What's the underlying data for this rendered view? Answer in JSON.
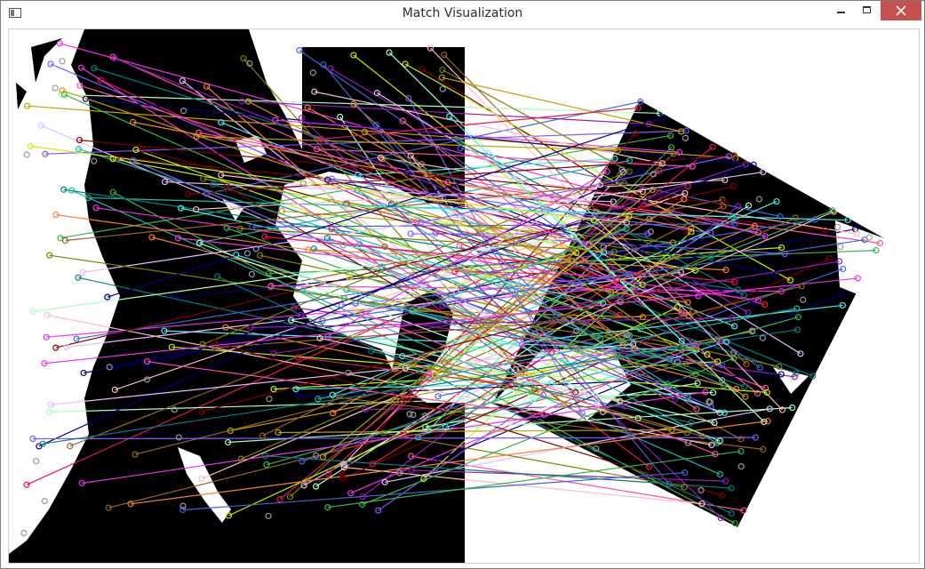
{
  "window": {
    "title": "Match Visualization"
  },
  "controls": {
    "minimize": "minimize",
    "maximize": "maximize",
    "close": "close"
  },
  "colors": {
    "close_button": "#c75050",
    "image_black": "#000000",
    "image_white": "#ffffff",
    "keypoint_gray": "#9a9a9a"
  },
  "visualization": {
    "left_image": "binary map image",
    "right_image": "rotated binary map image",
    "match_line_palette": [
      "#e6194b",
      "#3cb44b",
      "#4363d8",
      "#f58231",
      "#911eb4",
      "#46f0f0",
      "#f032e6",
      "#bcf60c",
      "#fabebe",
      "#008080",
      "#e6beff",
      "#9a6324",
      "#800000",
      "#aaffc3",
      "#808000",
      "#000075",
      "#ff4fa3",
      "#21b6a8",
      "#7d5cff",
      "#c4a000"
    ]
  }
}
